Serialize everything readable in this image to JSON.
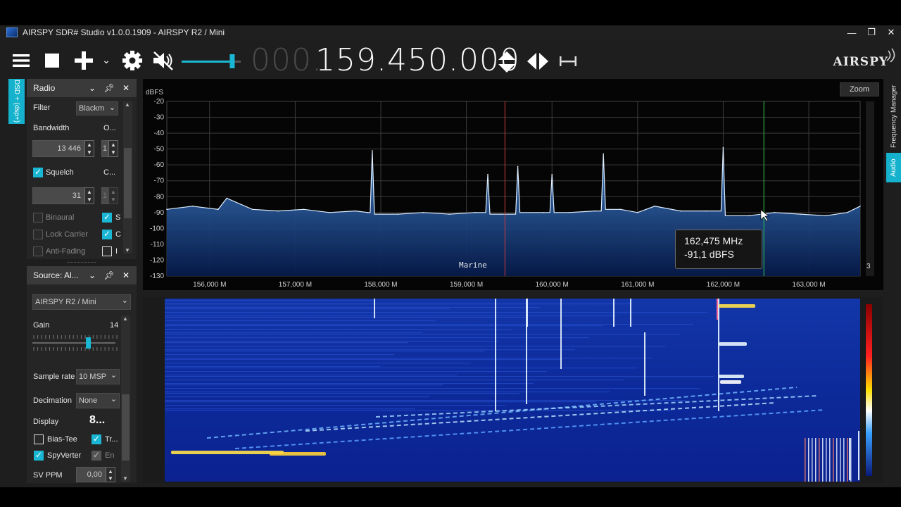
{
  "window": {
    "title": "AIRSPY SDR# Studio v1.0.0.1909 - AIRSPY R2 / Mini",
    "minimize": "—",
    "maximize": "❐",
    "close": "✕"
  },
  "toolbar": {
    "menu_icon": "hamburger-icon",
    "stop_icon": "stop-icon",
    "add_icon": "plus-icon",
    "add_dropdown": "⌄",
    "settings_icon": "gear-icon",
    "mute_icon": "speaker-muted-icon",
    "volume_level": 0.9,
    "frequency_dim": "000.",
    "frequency_main": "159.450.000",
    "tune_updown_icon": "updown-arrows-icon",
    "tune_leftright_icon": "leftright-arrows-icon",
    "center_icon": "span-icon",
    "brand": "AIRSPY"
  },
  "sidetabs": {
    "left": "DSD + (dsp+)",
    "right_frequency_manager": "Frequency Manager",
    "right_audio": "Audio"
  },
  "radio_panel": {
    "title": "Radio",
    "filter_label": "Filter",
    "filter_value": "Blackm",
    "bandwidth_label": "Bandwidth",
    "order_label": "O...",
    "bandwidth_value": "13 446",
    "order_value": "1",
    "squelch_label": "Squelch",
    "squelch_checked": true,
    "cw_label": "C...",
    "squelch_value": "31",
    "cw_value": "1",
    "binaural_label": "Binaural",
    "binaural_checked": false,
    "s_label": "S",
    "s_checked": true,
    "lock_carrier_label": "Lock Carrier",
    "lock_carrier_checked": false,
    "c_label": "C",
    "c_checked": true,
    "anti_fading_label": "Anti-Fading",
    "anti_fading_checked": false,
    "i_label": "I",
    "i_checked": false
  },
  "source_panel": {
    "title": "Source: Al...",
    "device_value": "AIRSPY R2 / Mini",
    "gain_label": "Gain",
    "gain_value": "14",
    "gain_level": 0.67,
    "sample_rate_label": "Sample rate",
    "sample_rate_value": "10 MSP",
    "decimation_label": "Decimation",
    "decimation_value": "None",
    "display_label": "Display",
    "display_value": "8...",
    "bias_tee_label": "Bias-Tee",
    "bias_tee_checked": false,
    "tr_label": "Tr...",
    "tr_checked": true,
    "spyverter_label": "SpyVerter",
    "spyverter_checked": true,
    "en_label": "En",
    "en_checked": true,
    "sv_ppm_label": "SV PPM",
    "sv_ppm_value": "0,00"
  },
  "spectrum": {
    "unit_label": "dBFS",
    "zoom_label": "Zoom",
    "y_ticks": [
      "-20",
      "-30",
      "-40",
      "-50",
      "-60",
      "-70",
      "-80",
      "-90",
      "-100",
      "-110",
      "-120",
      "-130"
    ],
    "x_ticks": [
      "156,000 M",
      "157,000 M",
      "158,000 M",
      "159,000 M",
      "160,000 M",
      "161,000 M",
      "162,000 M",
      "163,000 M"
    ],
    "band_label": "Marine",
    "tooltip_freq": "162,475 MHz",
    "tooltip_level": "-91,1 dBFS",
    "scale_value": "3",
    "colors": {
      "fill_top": "#3f7fc8",
      "fill_bottom": "#061a4a",
      "trace": "#dfefff",
      "center_line": "#d03a3a",
      "cursor_line": "#2fbf4a"
    }
  },
  "chart_data": {
    "type": "line",
    "ylabel": "dBFS",
    "ylim": [
      -130,
      -20
    ],
    "xlim": [
      155.5,
      163.6
    ],
    "x": [
      155.5,
      155.8,
      156.1,
      156.2,
      156.5,
      156.8,
      157.1,
      157.4,
      157.7,
      157.85,
      157.9,
      158.2,
      158.5,
      158.8,
      159.1,
      159.25,
      159.4,
      159.6,
      159.9,
      160.0,
      160.2,
      160.5,
      160.6,
      160.8,
      161.0,
      161.2,
      161.5,
      161.8,
      162.0,
      162.3,
      162.6,
      162.9,
      163.2,
      163.45,
      163.6
    ],
    "values": [
      -88,
      -86,
      -88,
      -81,
      -88,
      -89,
      -88,
      -90,
      -89,
      -90,
      -51,
      -91,
      -90,
      -91,
      -90,
      -66,
      -91,
      -61,
      -90,
      -66,
      -90,
      -89,
      -53,
      -88,
      -90,
      -86,
      -89,
      -89,
      -49,
      -92,
      -90,
      -91,
      -92,
      -90,
      -86
    ]
  }
}
